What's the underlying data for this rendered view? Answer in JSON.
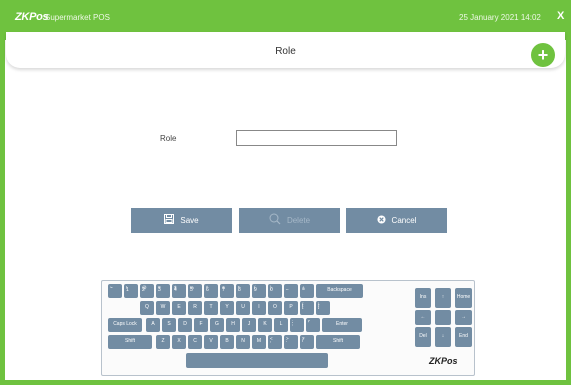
{
  "app": {
    "brand": "ZKPos",
    "name": "Supermarket POS",
    "datetime": "25 January 2021 14:02",
    "close_label": "X"
  },
  "header": {
    "title": "Role",
    "add_label": "+"
  },
  "form": {
    "role_label": "Role",
    "role_value": "",
    "role_placeholder": ""
  },
  "actions": {
    "save": "Save",
    "delete": "Delete",
    "cancel": "Cancel"
  },
  "keyboard": {
    "row1": [
      {
        "top": "~",
        "bottom": "`"
      },
      {
        "top": "!",
        "bottom": "1"
      },
      {
        "top": "@",
        "bottom": "2"
      },
      {
        "top": "#",
        "bottom": "3"
      },
      {
        "top": "$",
        "bottom": "4"
      },
      {
        "top": "%",
        "bottom": "5"
      },
      {
        "top": "^",
        "bottom": "6"
      },
      {
        "top": "&",
        "bottom": "7"
      },
      {
        "top": "*",
        "bottom": "8"
      },
      {
        "top": "(",
        "bottom": "9"
      },
      {
        "top": ")",
        "bottom": "0"
      },
      {
        "top": "_",
        "bottom": "-"
      },
      {
        "top": "+",
        "bottom": "="
      }
    ],
    "backspace": "Backspace",
    "row2": [
      "Q",
      "W",
      "E",
      "R",
      "T",
      "Y",
      "U",
      "I",
      "O",
      "P"
    ],
    "row2_brackets": [
      {
        "top": "{",
        "bottom": "["
      },
      {
        "top": "}",
        "bottom": "]"
      }
    ],
    "caps": "Caps Lock",
    "row3": [
      "A",
      "S",
      "D",
      "F",
      "G",
      "H",
      "J",
      "K",
      "L"
    ],
    "row3_punct": [
      {
        "top": ":",
        "bottom": ";"
      },
      {
        "top": "\"",
        "bottom": "'"
      }
    ],
    "enter": "Enter",
    "shift": "Shift",
    "row4": [
      "Z",
      "X",
      "C",
      "V",
      "B",
      "N",
      "M"
    ],
    "row4_punct": [
      {
        "top": "<",
        "bottom": ","
      },
      {
        "top": ">",
        "bottom": "."
      },
      {
        "top": "?",
        "bottom": "/"
      }
    ],
    "nav": {
      "ins": "Ins",
      "home": "Home",
      "del": "Del",
      "end": "End",
      "up": "↑",
      "down": "↓",
      "left": "←",
      "right": "→"
    },
    "logo": "ZKPos"
  }
}
